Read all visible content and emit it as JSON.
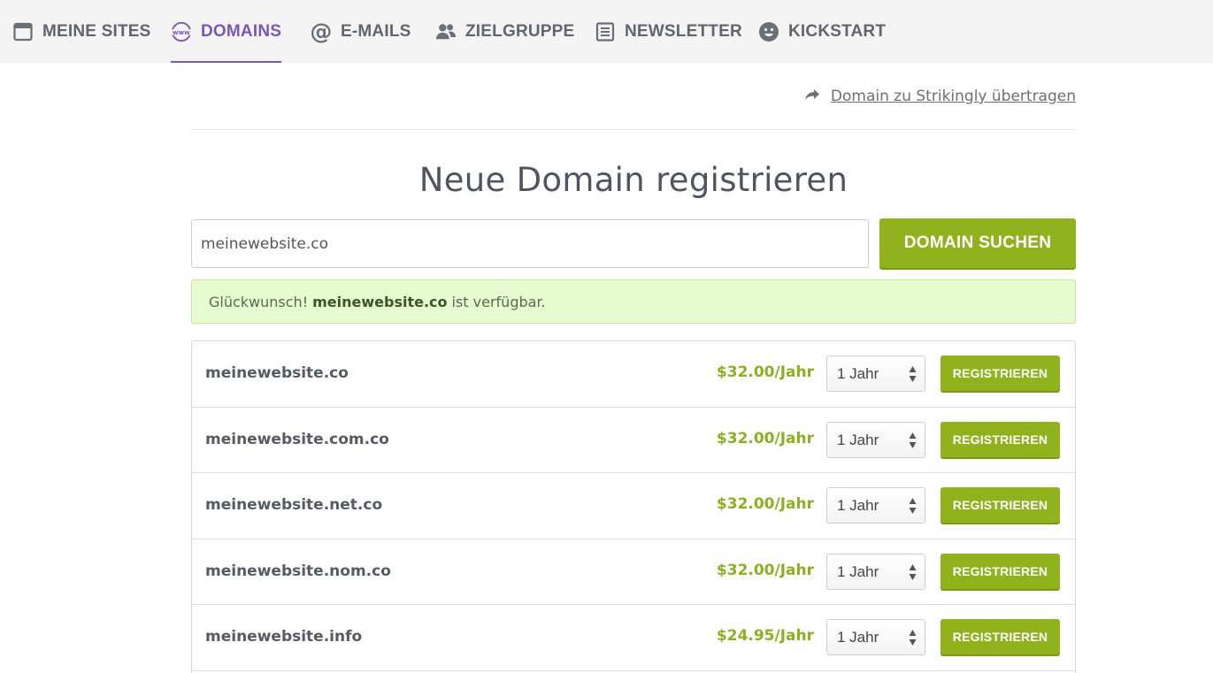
{
  "nav": {
    "items": [
      {
        "label": "MEINE SITES",
        "icon": "browser-window-icon"
      },
      {
        "label": "DOMAINS",
        "icon": "www-globe-icon",
        "active": true
      },
      {
        "label": "E-MAILS",
        "icon": "at-sign-icon"
      },
      {
        "label": "ZIELGRUPPE",
        "icon": "users-icon"
      },
      {
        "label": "NEWSLETTER",
        "icon": "newsletter-icon"
      },
      {
        "label": "KICKSTART",
        "icon": "smiley-icon"
      }
    ],
    "active_color": "#7b59b1"
  },
  "transfer": {
    "label": "Domain zu Strikingly übertragen",
    "icon": "share-arrow-icon"
  },
  "page": {
    "title": "Neue Domain registrieren"
  },
  "search": {
    "value": "meinewebsite.co",
    "button_label": "DOMAIN SUCHEN"
  },
  "alert": {
    "prefix": "Glückwunsch!",
    "domain": "meinewebsite.co",
    "suffix": "ist verfügbar."
  },
  "results": [
    {
      "domain": "meinewebsite.co",
      "price": "$32.00/Jahr",
      "term": "1 Jahr",
      "button": "REGISTRIEREN"
    },
    {
      "domain": "meinewebsite.com.co",
      "price": "$32.00/Jahr",
      "term": "1 Jahr",
      "button": "REGISTRIEREN"
    },
    {
      "domain": "meinewebsite.net.co",
      "price": "$32.00/Jahr",
      "term": "1 Jahr",
      "button": "REGISTRIEREN"
    },
    {
      "domain": "meinewebsite.nom.co",
      "price": "$32.00/Jahr",
      "term": "1 Jahr",
      "button": "REGISTRIEREN"
    },
    {
      "domain": "meinewebsite.info",
      "price": "$24.95/Jahr",
      "term": "1 Jahr",
      "button": "REGISTRIEREN"
    }
  ],
  "colors": {
    "accent_green": "#8fb21d",
    "price_green": "#8ab11f",
    "success_bg": "#e6fbd0"
  }
}
